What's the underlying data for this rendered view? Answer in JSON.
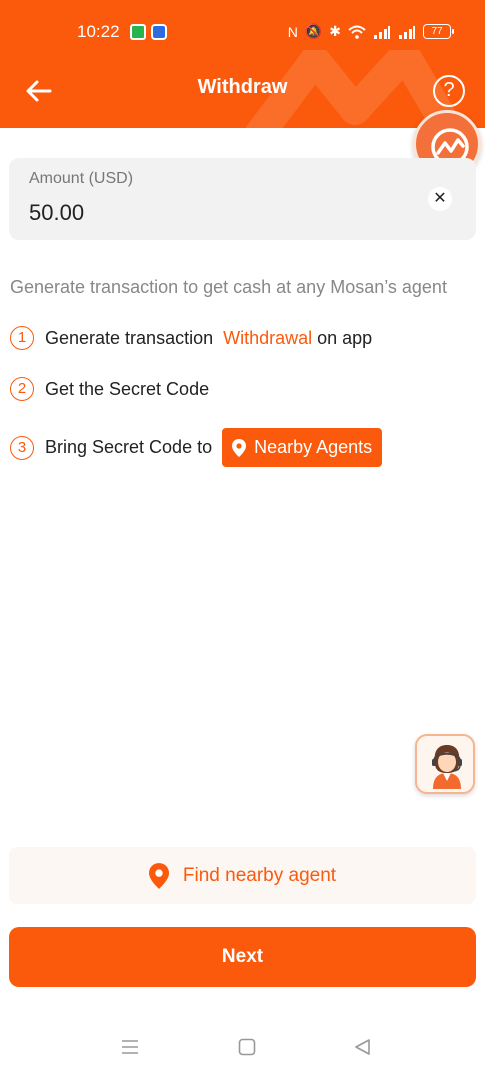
{
  "status_bar": {
    "time": "10:22",
    "battery": "77",
    "icons": [
      "nfc-icon",
      "mute-icon",
      "bluetooth-icon",
      "wifi-icon",
      "signal-icon",
      "signal-icon",
      "battery-icon"
    ]
  },
  "header": {
    "title": "Withdraw",
    "back_icon": "arrow-left-icon",
    "help_label": "?"
  },
  "amount": {
    "label": "Amount (USD)",
    "value": "50.00",
    "clear_label": "✕"
  },
  "instructions": {
    "intro": "Generate transaction to get cash at any Mosan’s agent",
    "steps": [
      {
        "number": "1",
        "text": "Generate transaction",
        "highlight": "Withdrawal",
        "suffix": "on app"
      },
      {
        "number": "2",
        "text": "Get the Secret Code"
      },
      {
        "number": "3",
        "text": "Bring Secret Code to",
        "button": "Nearby Agents"
      }
    ]
  },
  "find_agent": {
    "label": "Find nearby agent"
  },
  "next_button": {
    "label": "Next"
  },
  "colors": {
    "accent": "#fb5a0c",
    "input_bg": "#f2f2f2",
    "muted_text": "#888888"
  }
}
